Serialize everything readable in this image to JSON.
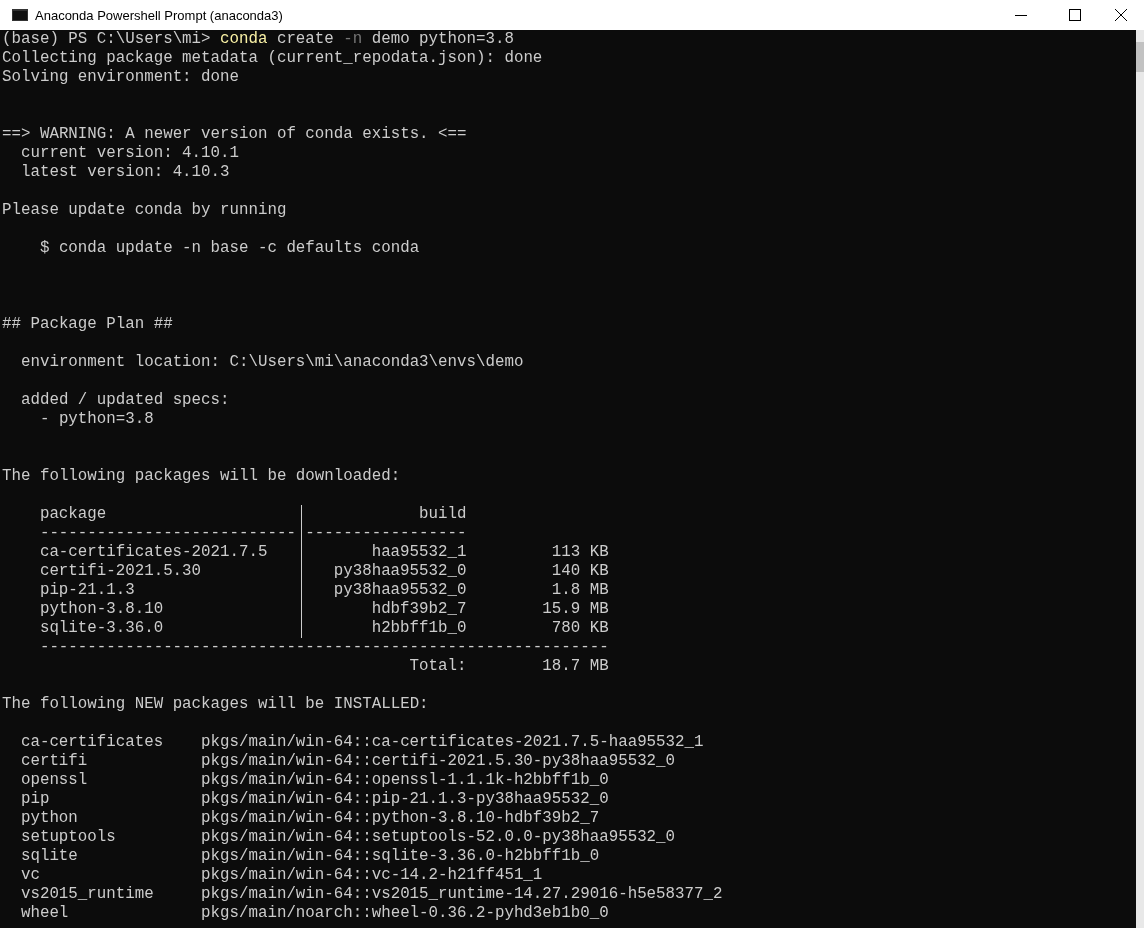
{
  "window": {
    "title": "Anaconda Powershell Prompt (anaconda3)"
  },
  "lines": [
    {
      "kind": "command",
      "segments": [
        {
          "kind": "prompt",
          "text": "(base) PS C:\\Users\\mi>"
        },
        {
          "kind": "program",
          "text": "conda"
        },
        {
          "kind": "arg",
          "text": "create"
        },
        {
          "kind": "flag",
          "text": "-n"
        },
        {
          "kind": "arg",
          "text": "demo python=3.8"
        }
      ]
    },
    {
      "kind": "text",
      "text": "Collecting package metadata (current_repodata.json): done"
    },
    {
      "kind": "text",
      "text": "Solving environment: done"
    },
    {
      "kind": "blank"
    },
    {
      "kind": "blank"
    },
    {
      "kind": "text",
      "text": "==> WARNING: A newer version of conda exists. <=="
    },
    {
      "kind": "text",
      "text": "  current version: 4.10.1"
    },
    {
      "kind": "text",
      "text": "  latest version: 4.10.3"
    },
    {
      "kind": "blank"
    },
    {
      "kind": "text",
      "text": "Please update conda by running"
    },
    {
      "kind": "blank"
    },
    {
      "kind": "text",
      "text": "    $ conda update -n base -c defaults conda"
    },
    {
      "kind": "blank"
    },
    {
      "kind": "blank"
    },
    {
      "kind": "blank"
    },
    {
      "kind": "text",
      "text": "## Package Plan ##"
    },
    {
      "kind": "blank"
    },
    {
      "kind": "text",
      "text": "  environment location: C:\\Users\\mi\\anaconda3\\envs\\demo"
    },
    {
      "kind": "blank"
    },
    {
      "kind": "text",
      "text": "  added / updated specs:"
    },
    {
      "kind": "text",
      "text": "    - python=3.8"
    },
    {
      "kind": "blank"
    },
    {
      "kind": "blank"
    },
    {
      "kind": "text",
      "text": "The following packages will be downloaded:"
    },
    {
      "kind": "blank"
    },
    {
      "kind": "table_head",
      "package": "package",
      "build": "build"
    },
    {
      "kind": "table_rule",
      "package": "---------------------------",
      "build": "-----------------"
    },
    {
      "kind": "table_row",
      "package": "ca-certificates-2021.7.5",
      "build": "haa95532_1",
      "size": "113 KB"
    },
    {
      "kind": "table_row",
      "package": "certifi-2021.5.30",
      "build": "py38haa95532_0",
      "size": "140 KB"
    },
    {
      "kind": "table_row",
      "package": "pip-21.1.3",
      "build": "py38haa95532_0",
      "size": "1.8 MB"
    },
    {
      "kind": "table_row",
      "package": "python-3.8.10",
      "build": "hdbf39b2_7",
      "size": "15.9 MB"
    },
    {
      "kind": "table_row",
      "package": "sqlite-3.36.0",
      "build": "h2bbff1b_0",
      "size": "780 KB"
    },
    {
      "kind": "table_rule",
      "package": "------------------------------------------------------------"
    },
    {
      "kind": "table_total",
      "label": "Total:",
      "size": "18.7 MB"
    },
    {
      "kind": "blank"
    },
    {
      "kind": "text",
      "text": "The following NEW packages will be INSTALLED:"
    },
    {
      "kind": "blank"
    },
    {
      "kind": "install_row",
      "name": "ca-certificates",
      "spec": "pkgs/main/win-64::ca-certificates-2021.7.5-haa95532_1"
    },
    {
      "kind": "install_row",
      "name": "certifi",
      "spec": "pkgs/main/win-64::certifi-2021.5.30-py38haa95532_0"
    },
    {
      "kind": "install_row",
      "name": "openssl",
      "spec": "pkgs/main/win-64::openssl-1.1.1k-h2bbff1b_0"
    },
    {
      "kind": "install_row",
      "name": "pip",
      "spec": "pkgs/main/win-64::pip-21.1.3-py38haa95532_0"
    },
    {
      "kind": "install_row",
      "name": "python",
      "spec": "pkgs/main/win-64::python-3.8.10-hdbf39b2_7"
    },
    {
      "kind": "install_row",
      "name": "setuptools",
      "spec": "pkgs/main/win-64::setuptools-52.0.0-py38haa95532_0"
    },
    {
      "kind": "install_row",
      "name": "sqlite",
      "spec": "pkgs/main/win-64::sqlite-3.36.0-h2bbff1b_0"
    },
    {
      "kind": "install_row",
      "name": "vc",
      "spec": "pkgs/main/win-64::vc-14.2-h21ff451_1"
    },
    {
      "kind": "install_row",
      "name": "vs2015_runtime",
      "spec": "pkgs/main/win-64::vs2015_runtime-14.27.29016-h5e58377_2"
    },
    {
      "kind": "install_row",
      "name": "wheel",
      "spec": "pkgs/main/noarch::wheel-0.36.2-pyhd3eb1b0_0"
    }
  ]
}
